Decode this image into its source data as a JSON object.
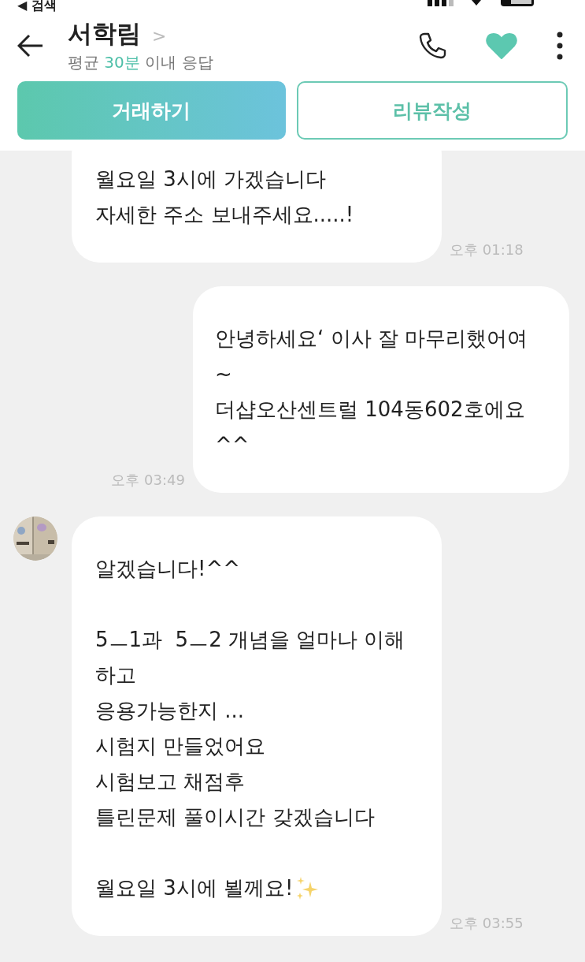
{
  "status_bar": {
    "back_label": "◀ 검색"
  },
  "header": {
    "name": "서학림",
    "name_chevron": ">",
    "response": {
      "prefix": "평균",
      "highlight": "30분",
      "suffix": "이내 응답"
    },
    "favorite": true
  },
  "actions": [
    {
      "label": "거래하기",
      "kind": "primary"
    },
    {
      "label": "리뷰작성",
      "kind": "outline"
    }
  ],
  "messages": [
    {
      "kind": "incoming",
      "avatar": false,
      "paragraphs": [
        [
          "월요일 3시에 가겠습니다",
          "자세한 주소 보내주세요.....!"
        ]
      ],
      "time": "오후 01:18"
    },
    {
      "kind": "outgoing",
      "avatar": false,
      "paragraphs": [
        [
          "안녕하세요‘ 이사 잘 마무리했어여",
          "~",
          "더샵오산센트럴 104동602호에요",
          "^^"
        ]
      ],
      "time": "오후 03:49"
    },
    {
      "kind": "incoming",
      "avatar": true,
      "paragraphs": [
        [
          "알겠습니다!^^"
        ],
        [
          "5ㅡ1과  5ㅡ2 개념을 얼마나 이해",
          "하고",
          "응용가능한지 ...",
          "시험지 만들었어요",
          "시험보고 채점후",
          "틀린문제 풀이시간 갖겠습니다"
        ],
        [
          "월요일 3시에 뵐께요!"
        ]
      ],
      "sparkle_last": true,
      "time": "오후 03:55"
    }
  ]
}
